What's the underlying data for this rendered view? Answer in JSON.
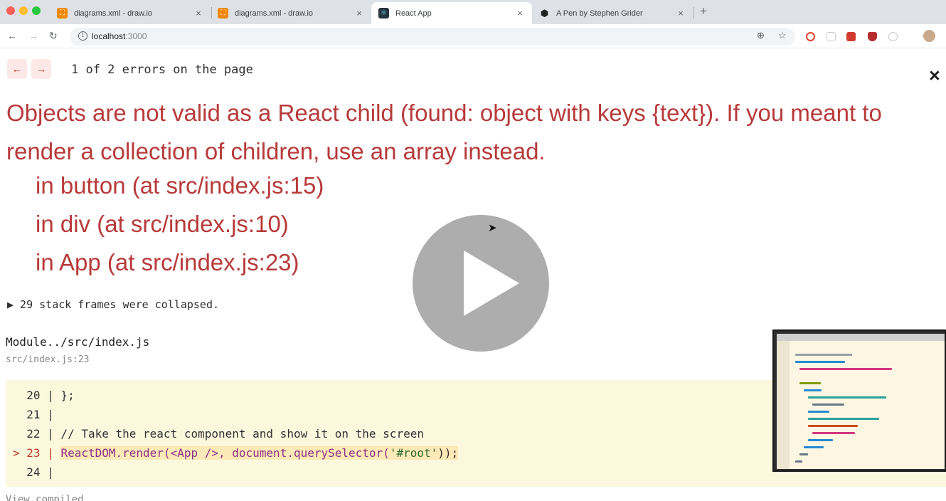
{
  "browser": {
    "tabs": [
      {
        "title": "diagrams.xml - draw.io",
        "icon": "drawio-favicon",
        "active": false
      },
      {
        "title": "diagrams.xml - draw.io",
        "icon": "drawio-favicon",
        "active": false
      },
      {
        "title": "React App",
        "icon": "react-favicon",
        "active": true
      },
      {
        "title": "A Pen by Stephen Grider",
        "icon": "codepen-favicon",
        "active": false
      }
    ],
    "new_tab_label": "+",
    "close_glyph": "×",
    "address": {
      "host": "localhost",
      "port": ":3000"
    }
  },
  "overlay": {
    "nav_prev": "←",
    "nav_next": "→",
    "error_count": "1 of 2 errors on the page",
    "close_glyph": "×",
    "message": "Objects are not valid as a React child (found: object with keys {text}). If you meant to render a collection of children, use an array instead.",
    "frames": [
      "in button (at src/index.js:15)",
      "in div (at src/index.js:10)",
      "in App (at src/index.js:23)"
    ],
    "collapsed": "▶ 29 stack frames were collapsed.",
    "module": "Module../src/index.js",
    "module_location": "src/index.js:23",
    "code": {
      "line20": "  20 | };",
      "line21": "  21 |",
      "line22": "  22 | // Take the react component and show it on the screen",
      "line23_marker": "> 23 | ",
      "line23_a": "ReactDOM.render(<App />, document.querySelector(",
      "line23_str": "'#root'",
      "line23_b": "));",
      "line24": "  24 |"
    },
    "view_compiled": "View compiled"
  },
  "colors": {
    "error_red": "#b83a3a",
    "code_bg": "#fbf8de",
    "highlight_bg": "#fbe9b7"
  }
}
